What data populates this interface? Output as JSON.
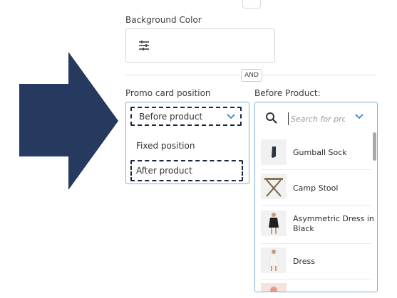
{
  "background_color": {
    "label": "Background Color",
    "icon": "sliders-icon"
  },
  "divider": {
    "label": "AND"
  },
  "promo_card_position": {
    "label": "Promo card position",
    "selected": "Before product",
    "options": [
      "Fixed position",
      "After product"
    ]
  },
  "before_product": {
    "label": "Before Product:",
    "search_placeholder": "Search for pro",
    "items": [
      {
        "name": "Gumball Sock"
      },
      {
        "name": "Camp Stool"
      },
      {
        "name": "Asymmetric Dress in Black"
      },
      {
        "name": "Dress"
      }
    ]
  },
  "annotation": {
    "arrow_color": "#253a5e",
    "focus_outline_color": "#1b2740",
    "accent": "#4a90c8"
  }
}
